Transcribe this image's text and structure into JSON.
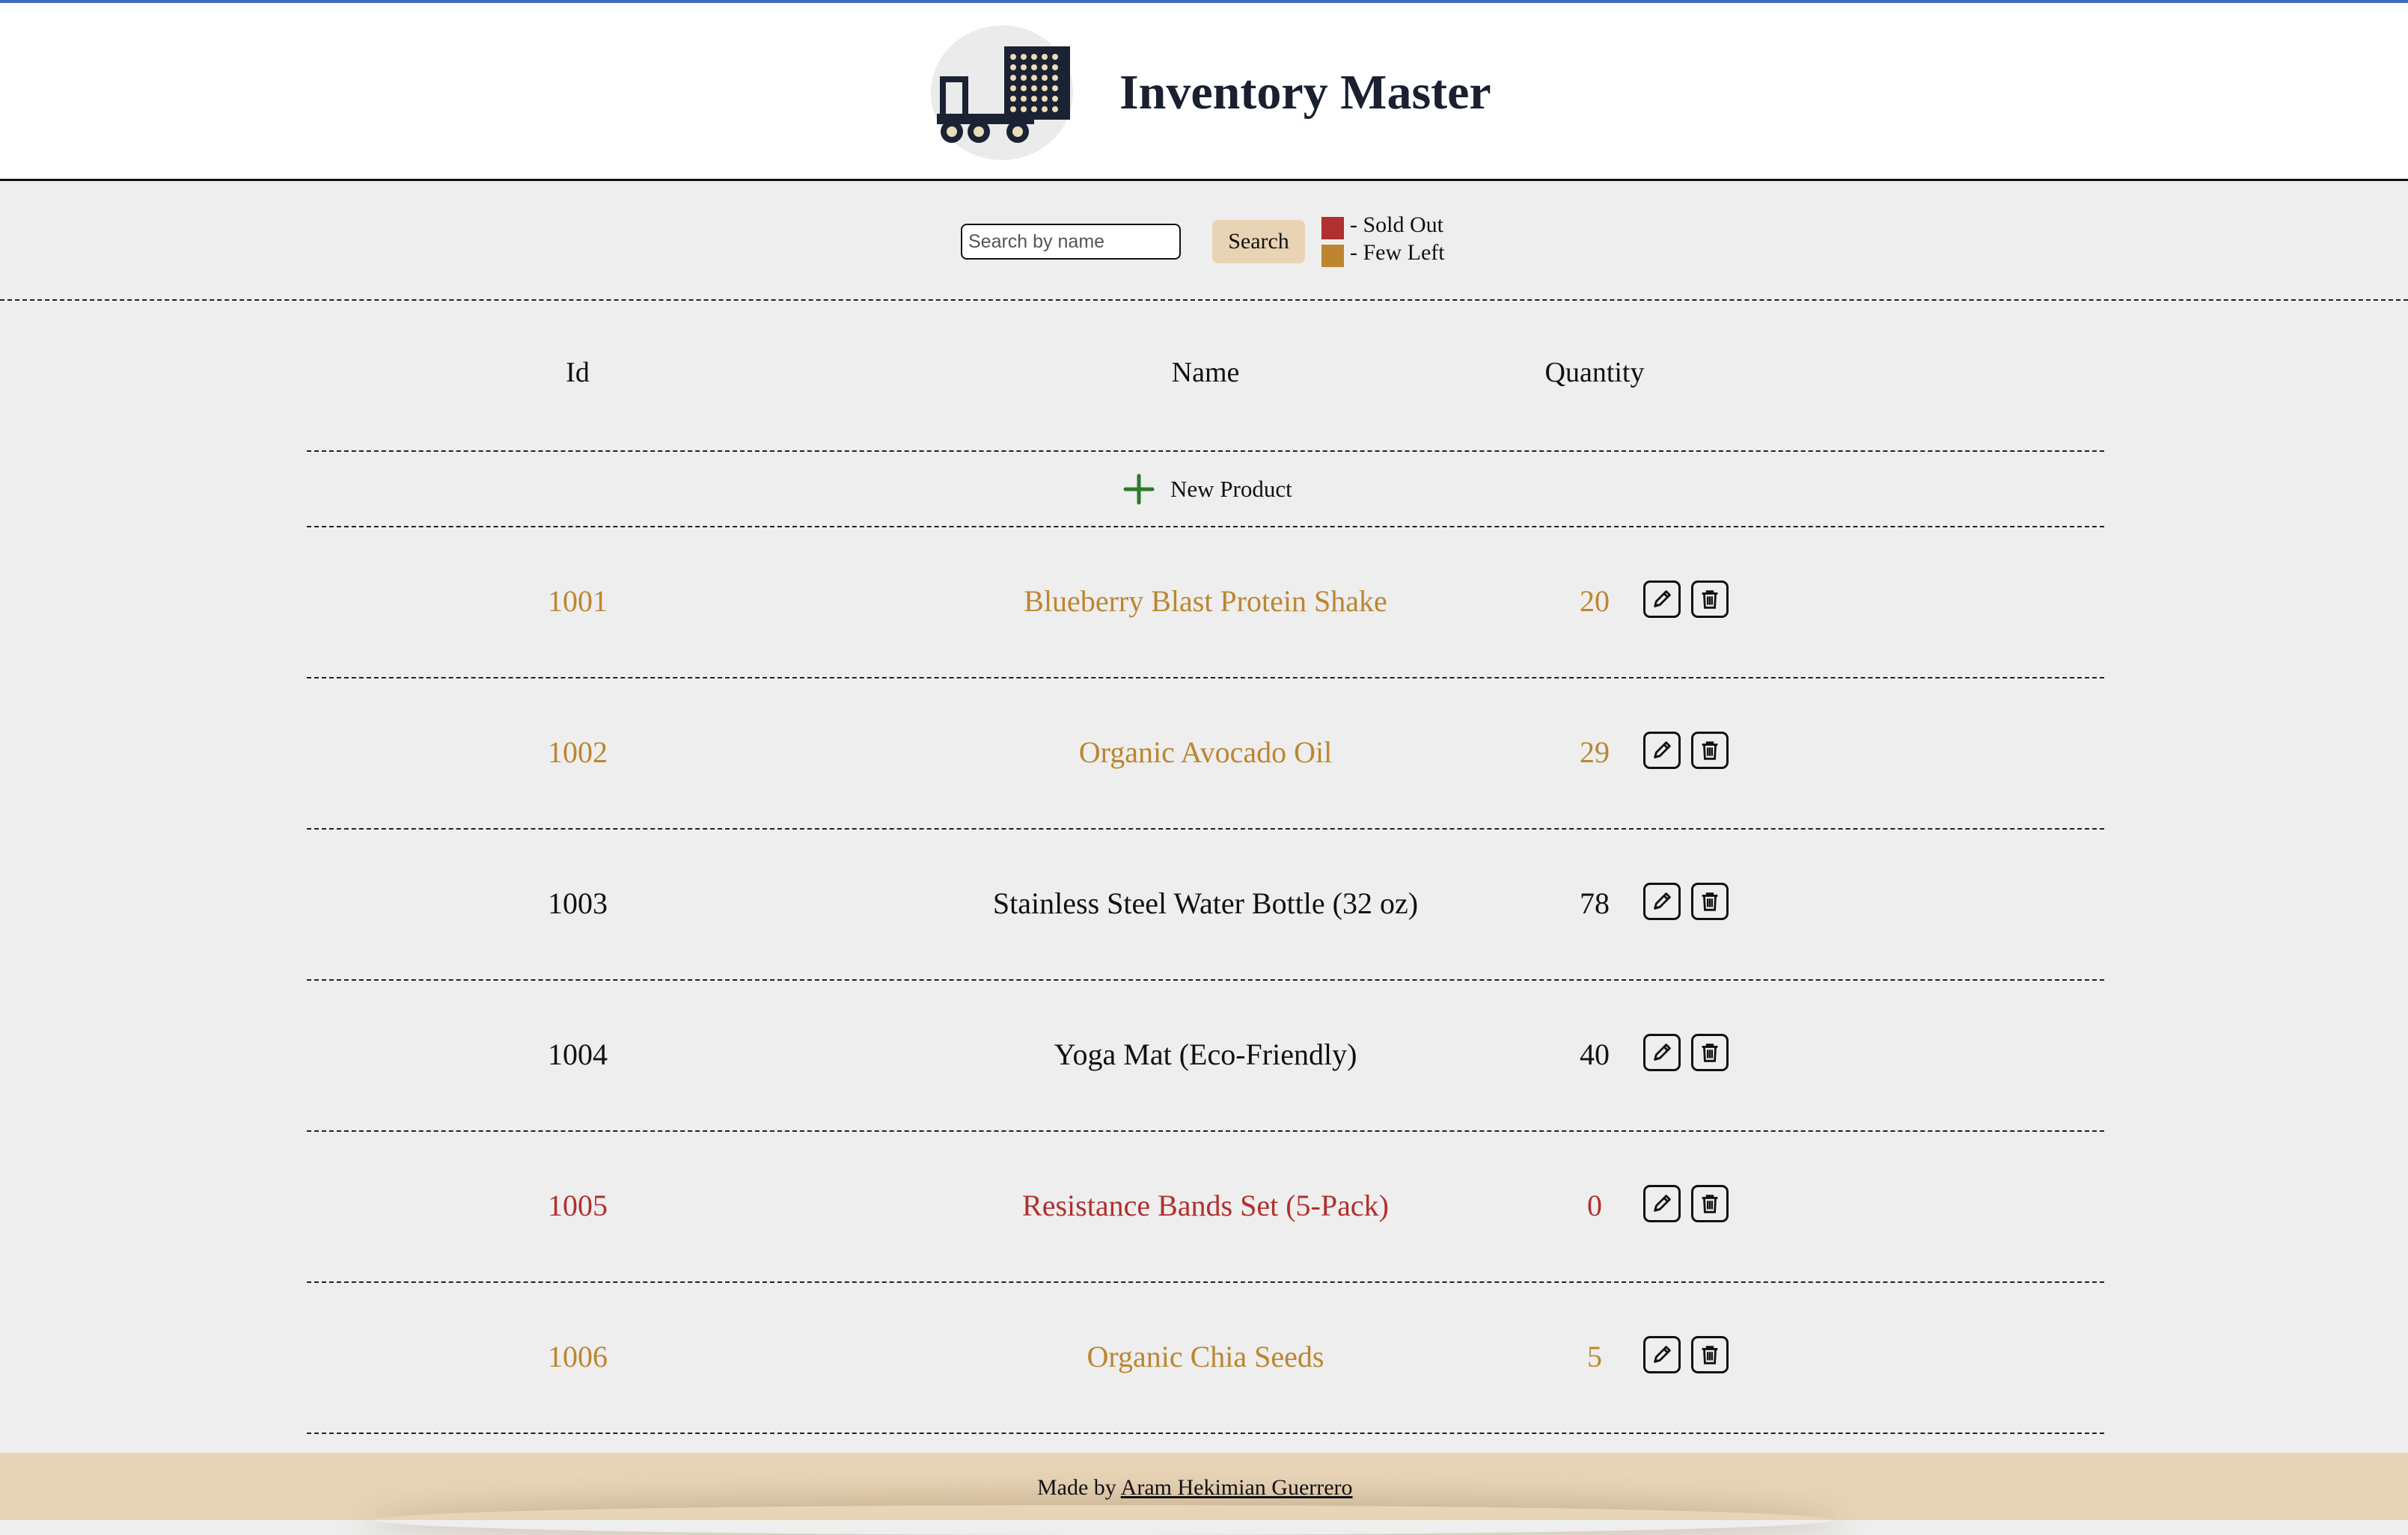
{
  "header": {
    "title": "Inventory Master"
  },
  "toolbar": {
    "search_placeholder": "Search by name",
    "search_button": "Search",
    "legend": [
      {
        "label": "- Sold Out",
        "color": "#b0302f"
      },
      {
        "label": "- Few Left",
        "color": "#bd8530"
      }
    ]
  },
  "table": {
    "columns": [
      "Id",
      "Name",
      "Quantity"
    ],
    "new_product_label": "New Product",
    "rows": [
      {
        "id": "1001",
        "name": "Blueberry Blast Protein Shake",
        "quantity": "20",
        "status": "few-left"
      },
      {
        "id": "1002",
        "name": "Organic Avocado Oil",
        "quantity": "29",
        "status": "few-left"
      },
      {
        "id": "1003",
        "name": "Stainless Steel Water Bottle (32 oz)",
        "quantity": "78",
        "status": "normal"
      },
      {
        "id": "1004",
        "name": "Yoga Mat (Eco-Friendly)",
        "quantity": "40",
        "status": "normal"
      },
      {
        "id": "1005",
        "name": "Resistance Bands Set (5-Pack)",
        "quantity": "0",
        "status": "sold-out"
      },
      {
        "id": "1006",
        "name": "Organic Chia Seeds",
        "quantity": "5",
        "status": "few-left"
      }
    ]
  },
  "status_colors": {
    "normal": "#111111",
    "few-left": "#bd8530",
    "sold-out": "#b0302f"
  },
  "icons": {
    "edit": "pencil-icon",
    "delete": "trash-icon",
    "add": "plus-icon",
    "logo": "truck-logo-icon"
  },
  "footer": {
    "prefix": "Made by",
    "author": "Aram Hekimian Guerrero"
  }
}
